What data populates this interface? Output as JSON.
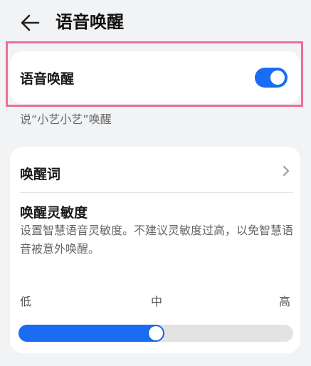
{
  "header": {
    "title": "语音唤醒"
  },
  "voice_wake": {
    "label": "语音唤醒",
    "enabled": true,
    "hint": "说“小艺小艺”唤醒"
  },
  "wake_word": {
    "label": "唤醒词"
  },
  "sensitivity": {
    "title": "唤醒灵敏度",
    "description": "设置智慧语音灵敏度。不建议灵敏度过高，以免智慧语音被意外唤醒。",
    "levels": [
      "低",
      "中",
      "高"
    ],
    "value": 0.5
  },
  "colors": {
    "accent": "#1a6cf3",
    "highlight": "#ef6d98"
  }
}
